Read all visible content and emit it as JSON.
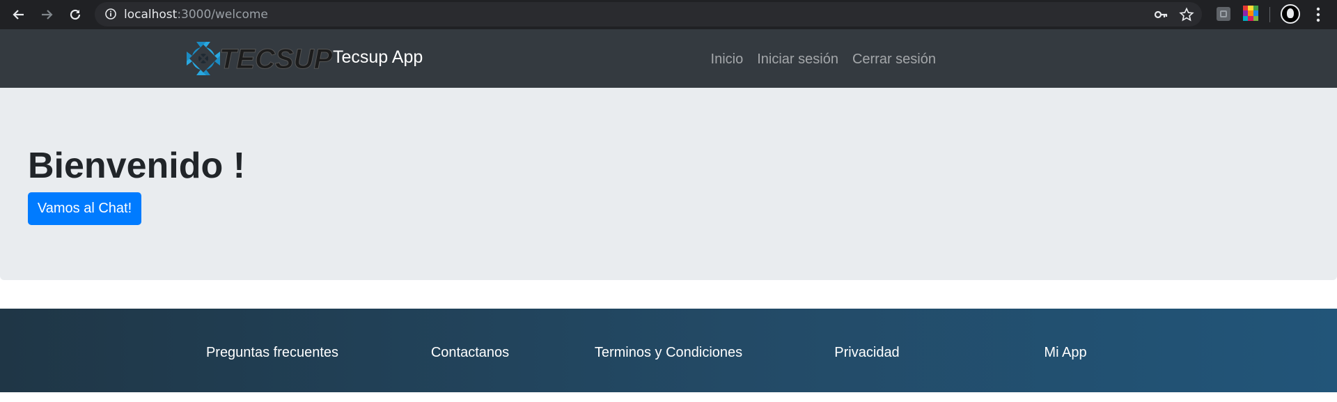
{
  "browser": {
    "url_host": "localhost",
    "url_rest": ":3000/welcome",
    "icons": [
      "back-arrow-icon",
      "forward-arrow-icon",
      "reload-icon",
      "info-icon",
      "key-icon",
      "star-icon",
      "extension-icon",
      "color-palette-extension-icon",
      "profile-avatar-icon",
      "more-menu-icon"
    ]
  },
  "navbar": {
    "brand": "Tecsup App",
    "logo_text": "TECSUP",
    "links": [
      "Inicio",
      "Iniciar sesión",
      "Cerrar sesión"
    ]
  },
  "hero": {
    "title": "Bienvenido !",
    "button": "Vamos al Chat!"
  },
  "footer": {
    "links": [
      "Preguntas frecuentes",
      "Contactanos",
      "Terminos y Condiciones",
      "Privacidad",
      "Mi App"
    ]
  },
  "colors": {
    "browser_chrome": "#202124",
    "navbar": "#343a40",
    "jumbotron": "#e9ecef",
    "primary_button": "#007bff",
    "footer_start": "#1f3646",
    "footer_end": "#225579",
    "logo_blue": "#29a8e0"
  }
}
